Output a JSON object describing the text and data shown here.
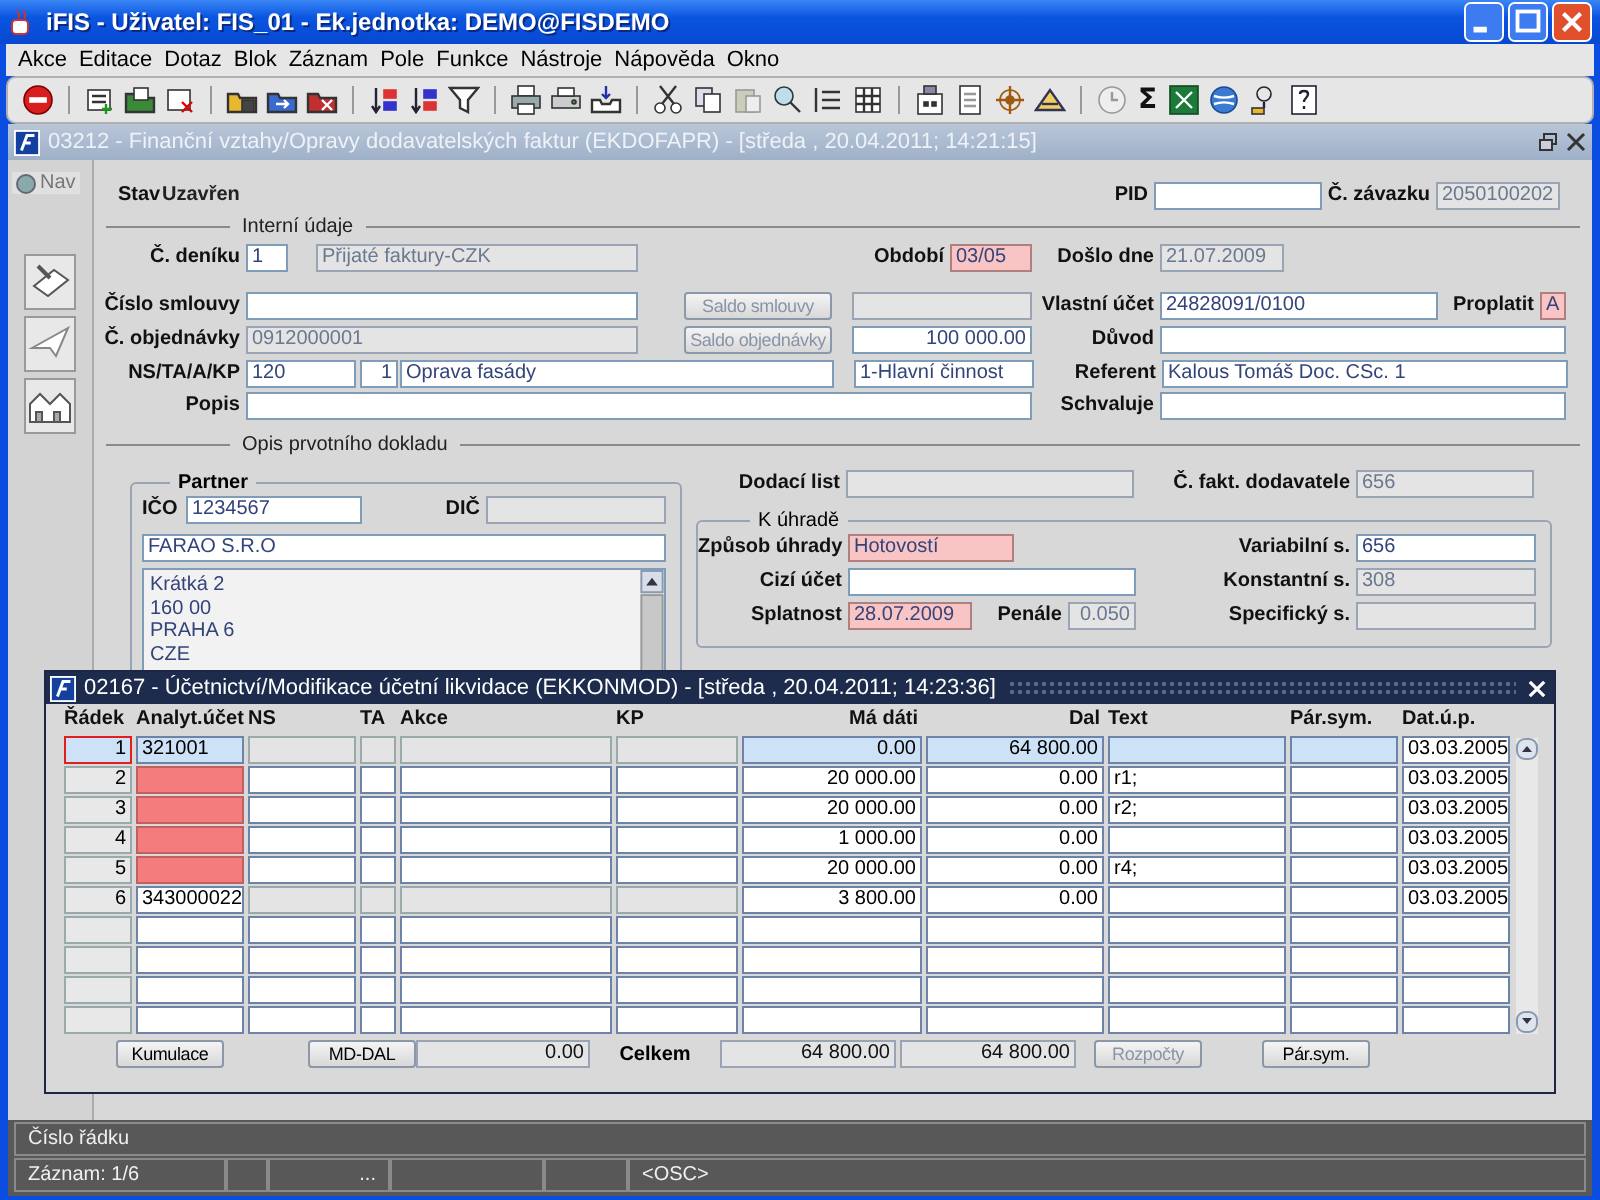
{
  "window": {
    "title": "iFIS - Uživatel: FIS_01 - Ek.jednotka: DEMO@FISDEMO"
  },
  "menu": [
    "Akce",
    "Editace",
    "Dotaz",
    "Blok",
    "Záznam",
    "Pole",
    "Funkce",
    "Nástroje",
    "Nápověda",
    "Okno"
  ],
  "toolbar": {
    "sum_symbol": "Σ"
  },
  "form_window": {
    "title": "03212 - Finanční vztahy/Opravy dodavatelských faktur (EKDOFAPR) - [středa , 20.04.2011; 14:21:15]"
  },
  "nav": {
    "label": "Nav",
    "selected": false
  },
  "header": {
    "stav": {
      "label": "Stav",
      "value": "Uzavřen"
    },
    "pid": {
      "label": "PID",
      "disabled": false,
      "required": false
    },
    "zavazek": {
      "label": "Č. závazku",
      "value": "2050100202",
      "disabled": true,
      "required": false
    }
  },
  "internal": {
    "title": "Interní údaje",
    "denik": {
      "label": "Č. deníku",
      "value": "1",
      "disabled": false,
      "required": false
    },
    "denik_name": {
      "value": "Přijaté faktury-CZK",
      "disabled": true,
      "required": false
    },
    "obdobi": {
      "label": "Období",
      "value": "03/05",
      "disabled": false,
      "required": true
    },
    "doslo": {
      "label": "Došlo dne",
      "value": "21.07.2009",
      "disabled": true,
      "required": false
    },
    "smlouva": {
      "label": "Číslo smlouvy",
      "disabled": false,
      "required": false
    },
    "saldo_smlouvy": {
      "label": "Saldo smlouvy",
      "disabled": true
    },
    "saldo_smlouvy_value": {
      "disabled": true,
      "required": false
    },
    "vlastni_ucet": {
      "label": "Vlastní účet",
      "value": "24828091/0100",
      "disabled": false,
      "required": false
    },
    "proplatit": {
      "label": "Proplatit",
      "value": "A",
      "disabled": false,
      "required": true
    },
    "objednavka": {
      "label": "Č. objednávky",
      "value": "0912000001",
      "disabled": true,
      "required": false
    },
    "saldo_objednavky": {
      "label": "Saldo objednávky",
      "disabled": true
    },
    "saldo_objednavky_value": {
      "value": "100 000.00",
      "disabled": false,
      "required": false
    },
    "duvod": {
      "label": "Důvod",
      "disabled": false,
      "required": false
    },
    "ns_label": "NS/TA/A/KP",
    "ns": {
      "value": "120",
      "disabled": false,
      "required": false
    },
    "ta": {
      "value": "1",
      "disabled": false,
      "required": false
    },
    "akce": {
      "value": "Oprava fasády",
      "disabled": false,
      "required": false
    },
    "cinnost": {
      "value": "1-Hlavní činnost",
      "disabled": false,
      "required": false
    },
    "referent": {
      "label": "Referent",
      "value": "Kalous Tomáš Doc. CSc. 1",
      "disabled": false,
      "required": false
    },
    "popis": {
      "label": "Popis",
      "disabled": false,
      "required": false
    },
    "schvaluje": {
      "label": "Schvaluje",
      "disabled": false,
      "required": false
    }
  },
  "document": {
    "title": "Opis prvotního dokladu",
    "partner": {
      "title": "Partner",
      "ico": {
        "label": "IČO",
        "value": "1234567",
        "disabled": false,
        "required": false
      },
      "dic": {
        "label": "DIČ",
        "disabled": true,
        "required": false
      },
      "name": {
        "value": "FARAO S.R.O",
        "disabled": false,
        "required": false
      },
      "address": [
        "Krátká 2",
        "160 00",
        "PRAHA 6",
        "CZE"
      ]
    },
    "dodaci_list": {
      "label": "Dodací list",
      "disabled": true,
      "required": false
    },
    "faktura": {
      "label": "Č. fakt. dodavatele",
      "value": "656",
      "disabled": true,
      "required": false
    },
    "payment": {
      "title": "K úhradě",
      "zpusob": {
        "label": "Způsob úhrady",
        "value": "Hotovostí",
        "disabled": false,
        "required": true
      },
      "variabilni": {
        "label": "Variabilní s.",
        "value": "656",
        "disabled": false,
        "required": false
      },
      "cizi_ucet": {
        "label": "Cizí účet",
        "disabled": false,
        "required": false
      },
      "konstantni": {
        "label": "Konstantní s.",
        "value": "308",
        "disabled": true,
        "required": false
      },
      "splatnost": {
        "label": "Splatnost",
        "value": "28.07.2009",
        "disabled": false,
        "required": true
      },
      "penale": {
        "label": "Penále",
        "value": "0.050",
        "disabled": true,
        "required": false
      },
      "specificky": {
        "label": "Specifický s.",
        "disabled": true,
        "required": false
      }
    }
  },
  "dialog": {
    "title": "02167 - Účetnictví/Modifikace účetní likvidace (EKKONMOD) - [středa , 20.04.2011; 14:23:36]",
    "columns": [
      "Řádek",
      "Analyt.účet",
      "NS",
      "TA",
      "Akce",
      "KP",
      "Má dáti",
      "Dal",
      "Text",
      "Pár.sym.",
      "Dat.ú.p."
    ],
    "rows": [
      {
        "selected": true,
        "locked": true,
        "account_missing": false,
        "radek": "1",
        "ucet": "321001",
        "ma_dati": "0.00",
        "dal": "64 800.00",
        "datum": "03.03.2005"
      },
      {
        "selected": false,
        "locked": false,
        "account_missing": true,
        "radek": "2",
        "ma_dati": "20 000.00",
        "dal": "0.00",
        "text": "r1;",
        "datum": "03.03.2005"
      },
      {
        "selected": false,
        "locked": false,
        "account_missing": true,
        "radek": "3",
        "ma_dati": "20 000.00",
        "dal": "0.00",
        "text": "r2;",
        "datum": "03.03.2005"
      },
      {
        "selected": false,
        "locked": false,
        "account_missing": true,
        "radek": "4",
        "ma_dati": "1 000.00",
        "dal": "0.00",
        "datum": "03.03.2005"
      },
      {
        "selected": false,
        "locked": false,
        "account_missing": true,
        "radek": "5",
        "ma_dati": "20 000.00",
        "dal": "0.00",
        "text": "r4;",
        "datum": "03.03.2005"
      },
      {
        "selected": false,
        "locked": true,
        "account_missing": false,
        "radek": "6",
        "ucet": "343000022",
        "ma_dati": "3 800.00",
        "dal": "0.00",
        "datum": "03.03.2005"
      },
      {
        "selected": false,
        "locked": false,
        "account_missing": false
      },
      {
        "selected": false,
        "locked": false,
        "account_missing": false
      },
      {
        "selected": false,
        "locked": false,
        "account_missing": false
      },
      {
        "selected": false,
        "locked": false,
        "account_missing": false
      }
    ],
    "footer": {
      "kumulace": {
        "label": "Kumulace",
        "disabled": false
      },
      "md_dal": {
        "label": "MD-DAL",
        "disabled": false
      },
      "md_dal_value": "0.00",
      "total_label": "Celkem",
      "total_md": "64 800.00",
      "total_dal": "64 800.00",
      "rozpocty": {
        "label": "Rozpočty",
        "disabled": true
      },
      "par_sym": {
        "label": "Pár.sym.",
        "disabled": false
      }
    }
  },
  "status_bar": {
    "hint": "Číslo řádku",
    "record": "Záznam: 1/6",
    "ellipsis": "...",
    "mode": "<OSC>"
  }
}
